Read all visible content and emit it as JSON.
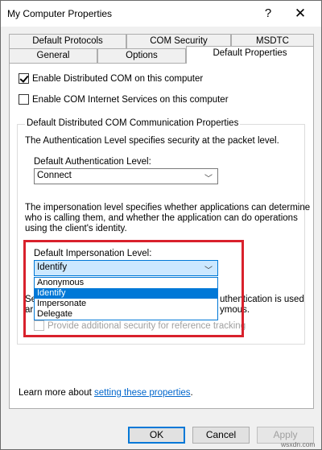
{
  "window": {
    "title": "My Computer Properties",
    "help_label": "?",
    "close_label": "✕"
  },
  "tabs": {
    "row1": [
      "Default Protocols",
      "COM Security",
      "MSDTC"
    ],
    "row2": [
      "General",
      "Options",
      "Default Properties"
    ]
  },
  "options": {
    "enable_dcom": "Enable Distributed COM on this computer",
    "enable_com_internet": "Enable COM Internet Services on this computer"
  },
  "group": {
    "label": "Default Distributed COM Communication Properties",
    "auth_desc": "The Authentication Level specifies security at the packet level.",
    "auth_label": "Default Authentication Level:",
    "auth_value": "Connect",
    "imp_desc_1": "The impersonation level specifies whether applications can determine",
    "imp_desc_2": "who is calling them, and whether the application can do operations",
    "imp_desc_3": "using the client's identity.",
    "imp_label": "Default Impersonation Level:",
    "imp_value": "Identify",
    "imp_options": [
      "Anonymous",
      "Identify",
      "Impersonate",
      "Delegate"
    ],
    "partial_left_1": "Se",
    "partial_left_2": "ar",
    "partial_right_1": "uthentication is used",
    "partial_right_2": "ymous.",
    "tracking_label": "Provide additional security for reference tracking"
  },
  "footer": {
    "learn_prefix": "Learn more about ",
    "learn_link": "setting these properties",
    "learn_suffix": "."
  },
  "buttons": {
    "ok": "OK",
    "cancel": "Cancel",
    "apply": "Apply"
  },
  "watermark": "wsxdn.com",
  "colors": {
    "accent": "#0078d7",
    "highlight": "#d9212c",
    "link": "#0066cc"
  }
}
